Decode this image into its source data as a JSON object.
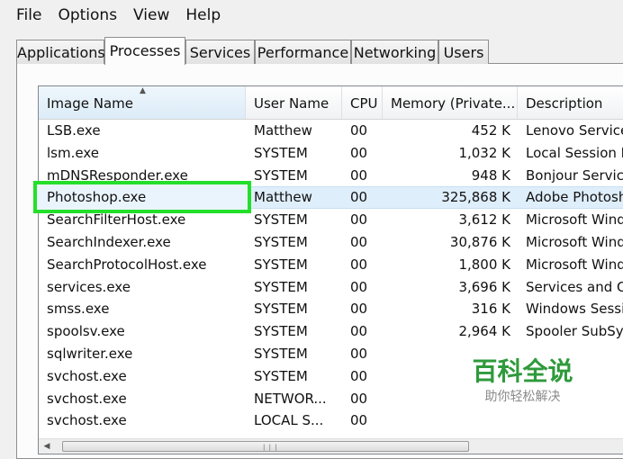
{
  "menu": [
    "File",
    "Options",
    "View",
    "Help"
  ],
  "tabs": [
    "Applications",
    "Processes",
    "Services",
    "Performance",
    "Networking",
    "Users"
  ],
  "active_tab": "Processes",
  "columns": [
    "Image Name",
    "User Name",
    "CPU",
    "Memory (Private...",
    "Description"
  ],
  "sorted_column": "Image Name",
  "rows": [
    {
      "name": "LSB.exe",
      "user": "Matthew",
      "cpu": "00",
      "mem": "452 K",
      "desc": "Lenovo Service"
    },
    {
      "name": "lsm.exe",
      "user": "SYSTEM",
      "cpu": "00",
      "mem": "1,032 K",
      "desc": "Local Session M"
    },
    {
      "name": "mDNSResponder.exe",
      "user": "SYSTEM",
      "cpu": "00",
      "mem": "948 K",
      "desc": "Bonjour Service"
    },
    {
      "name": "Photoshop.exe",
      "user": "Matthew",
      "cpu": "00",
      "mem": "325,868 K",
      "desc": "Adobe Photosh"
    },
    {
      "name": "SearchFilterHost.exe",
      "user": "SYSTEM",
      "cpu": "00",
      "mem": "3,612 K",
      "desc": "Microsoft Windo"
    },
    {
      "name": "SearchIndexer.exe",
      "user": "SYSTEM",
      "cpu": "00",
      "mem": "30,876 K",
      "desc": "Microsoft Windo"
    },
    {
      "name": "SearchProtocolHost.exe",
      "user": "SYSTEM",
      "cpu": "00",
      "mem": "1,800 K",
      "desc": "Microsoft Windo"
    },
    {
      "name": "services.exe",
      "user": "SYSTEM",
      "cpu": "00",
      "mem": "3,696 K",
      "desc": "Services and Co"
    },
    {
      "name": "smss.exe",
      "user": "SYSTEM",
      "cpu": "00",
      "mem": "316 K",
      "desc": "Windows Sessio"
    },
    {
      "name": "spoolsv.exe",
      "user": "SYSTEM",
      "cpu": "00",
      "mem": "2,964 K",
      "desc": "Spooler SubSys"
    },
    {
      "name": "sqlwriter.exe",
      "user": "SYSTEM",
      "cpu": "00",
      "mem": "",
      "desc": ""
    },
    {
      "name": "svchost.exe",
      "user": "SYSTEM",
      "cpu": "00",
      "mem": "",
      "desc": ""
    },
    {
      "name": "svchost.exe",
      "user": "NETWOR...",
      "cpu": "00",
      "mem": "",
      "desc": ""
    },
    {
      "name": "svchost.exe",
      "user": "LOCAL S...",
      "cpu": "00",
      "mem": "",
      "desc": ""
    }
  ],
  "selected_row": 3,
  "watermark": {
    "title": "百科全说",
    "subtitle": "助你轻松解决"
  },
  "colors": {
    "highlight": "#24df2a",
    "watermark_green": "#2f9a3c",
    "selection": "#dfeefb"
  }
}
